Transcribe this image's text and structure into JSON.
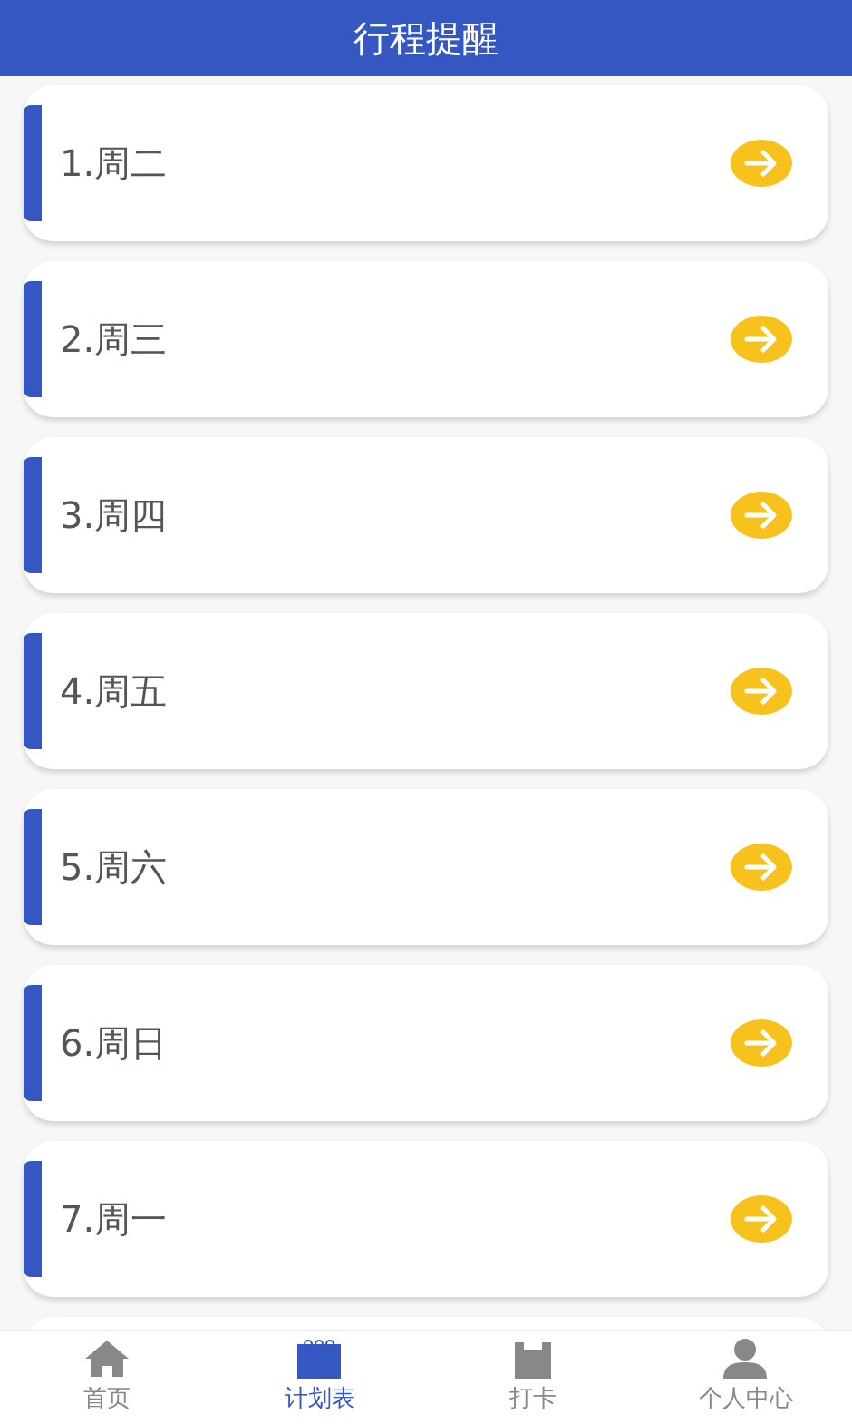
{
  "header": {
    "title": "行程提醒"
  },
  "items": [
    {
      "label": "1.周二"
    },
    {
      "label": "2.周三"
    },
    {
      "label": "3.周四"
    },
    {
      "label": "4.周五"
    },
    {
      "label": "5.周六"
    },
    {
      "label": "6.周日"
    },
    {
      "label": "7.周一"
    }
  ],
  "tab_bar": [
    {
      "label": "首页",
      "selected": false
    },
    {
      "label": "计划表",
      "selected": true
    },
    {
      "label": "打卡",
      "selected": false
    },
    {
      "label": "个人中心",
      "selected": false
    }
  ]
}
